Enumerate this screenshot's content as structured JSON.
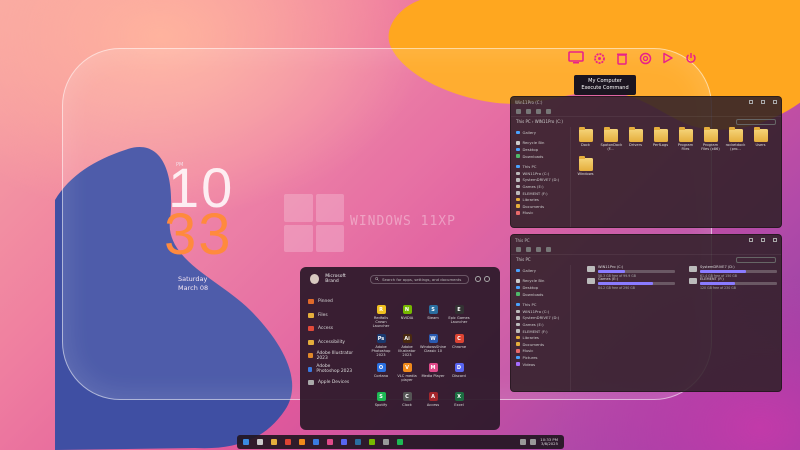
{
  "desktop": {
    "clock": {
      "small_label": "PM",
      "hour": "10",
      "minute": "33",
      "weekday": "Saturday",
      "date": "March 08"
    },
    "brand_title": "WINDOWS 11XP"
  },
  "top_icons": [
    {
      "name": "computer-icon",
      "color": "#e8218a"
    },
    {
      "name": "gear-icon",
      "color": "#e8218a"
    },
    {
      "name": "trash-icon",
      "color": "#e8218a"
    },
    {
      "name": "settings-icon",
      "color": "#e8218a"
    },
    {
      "name": "play-icon",
      "color": "#e8218a"
    },
    {
      "name": "power-icon",
      "color": "#e8218a"
    }
  ],
  "tooltip": {
    "title": "My Computer",
    "subtitle": "Execute Command"
  },
  "explorer1": {
    "title": "Win11Pro (C:)",
    "breadcrumb": "This PC  ›  WIN11Pro (C:)",
    "sidebar": [
      {
        "label": "Gallery",
        "color": "#4aa3ff"
      },
      {
        "label": "",
        "color": ""
      },
      {
        "label": "Recycle Bin",
        "color": "#cccccc"
      },
      {
        "label": "Desktop",
        "color": "#4aa3ff"
      },
      {
        "label": "Downloads",
        "color": "#4fb96a"
      },
      {
        "label": "",
        "color": ""
      },
      {
        "label": "This PC",
        "color": "#4aa3ff"
      },
      {
        "label": "WIN11Pro (C:)",
        "color": "#bbbbbb"
      },
      {
        "label": "SystemDRIVE7 (D:)",
        "color": "#bbbbbb"
      },
      {
        "label": "Games (E:)",
        "color": "#bbbbbb"
      },
      {
        "label": "ELEMENT (F:)",
        "color": "#bbbbbb"
      },
      {
        "label": "Libraries",
        "color": "#e5ae3c"
      },
      {
        "label": "Documents",
        "color": "#e5ae3c"
      },
      {
        "label": "Music",
        "color": "#e86a6a"
      }
    ],
    "folders": [
      "Dock",
      "SpotonDock (F...",
      "Drivers",
      "PerfLogs",
      "Program Files",
      "Program Files (x86)",
      "rocketdock (pro...",
      "Users",
      "Windows"
    ]
  },
  "explorer2": {
    "title": "This PC",
    "breadcrumb": "This PC",
    "sidebar": [
      {
        "label": "Gallery",
        "color": "#4aa3ff"
      },
      {
        "label": "",
        "color": ""
      },
      {
        "label": "Recycle Bin",
        "color": "#cccccc"
      },
      {
        "label": "Desktop",
        "color": "#4aa3ff"
      },
      {
        "label": "Downloads",
        "color": "#4fb96a"
      },
      {
        "label": "",
        "color": ""
      },
      {
        "label": "This PC",
        "color": "#4aa3ff"
      },
      {
        "label": "WIN11Pro (C:)",
        "color": "#bbbbbb"
      },
      {
        "label": "SystemDRIVE7 (D:)",
        "color": "#bbbbbb"
      },
      {
        "label": "Games (E:)",
        "color": "#bbbbbb"
      },
      {
        "label": "ELEMENT (F:)",
        "color": "#bbbbbb"
      },
      {
        "label": "Libraries",
        "color": "#e5ae3c"
      },
      {
        "label": "Documents",
        "color": "#e5ae3c"
      },
      {
        "label": "Music",
        "color": "#e86a6a"
      },
      {
        "label": "Pictures",
        "color": "#4aa3ff"
      },
      {
        "label": "Videos",
        "color": "#a66cff"
      }
    ],
    "drives": [
      {
        "name": "WIN11Pro (C:)",
        "used": 0.35,
        "free": "58.3 GB free of 99.9 GB"
      },
      {
        "name": "SystemDRIVE7 (D:)",
        "used": 0.6,
        "free": "61.4 GB free of 150 GB"
      },
      {
        "name": "Games (E:)",
        "used": 0.72,
        "free": "84.2 GB free of 290 GB"
      },
      {
        "name": "ELEMENT (F:)",
        "used": 0.45,
        "free": "120 GB free of 230 GB"
      }
    ]
  },
  "start_menu": {
    "user": "Microsoft Brand",
    "search_placeholder": "Search for apps, settings, and documents",
    "left": [
      {
        "label": "Pinned",
        "color": "#e06a2a"
      },
      {
        "label": "Files",
        "color": "#e5ae3c"
      },
      {
        "label": "Access",
        "color": "#e04a3a"
      },
      {
        "label": "Accessibility",
        "color": "#e5ae3c"
      },
      {
        "label": "Adobe Illustrator 2023",
        "color": "#e0882a"
      },
      {
        "label": "Adobe Photoshop 2023",
        "color": "#3a7ae0"
      },
      {
        "label": "Apple Devices",
        "color": "#aaaaaa"
      }
    ],
    "apps": [
      {
        "label": "Redfalls Crown Launcher",
        "icon": "R",
        "color": "#f0c020"
      },
      {
        "label": "NVIDIA",
        "icon": "N",
        "color": "#76b900"
      },
      {
        "label": "Steam",
        "icon": "S",
        "color": "#2a6ea0"
      },
      {
        "label": "Epic Games Launcher",
        "icon": "E",
        "color": "#333333"
      },
      {
        "label": "",
        "icon": "",
        "color": ""
      },
      {
        "label": "Adobe Photoshop 2023",
        "icon": "Ps",
        "color": "#1a3a70"
      },
      {
        "label": "Adobe Illustrator 2023",
        "icon": "Ai",
        "color": "#4a2a10"
      },
      {
        "label": "WindowsShine Classic 10",
        "icon": "W",
        "color": "#2a5ab0"
      },
      {
        "label": "Chrome",
        "icon": "C",
        "color": "#dd4433"
      },
      {
        "label": "",
        "icon": "",
        "color": ""
      },
      {
        "label": "Cortana",
        "icon": "O",
        "color": "#2a70e0"
      },
      {
        "label": "VLC media player",
        "icon": "V",
        "color": "#f08a1a"
      },
      {
        "label": "Media Player",
        "icon": "M",
        "color": "#e04a8a"
      },
      {
        "label": "Discord",
        "icon": "D",
        "color": "#5865f2"
      },
      {
        "label": "",
        "icon": "",
        "color": ""
      },
      {
        "label": "Spotify",
        "icon": "S",
        "color": "#1db954"
      },
      {
        "label": "Clock",
        "icon": "C",
        "color": "#555555"
      },
      {
        "label": "Access",
        "icon": "A",
        "color": "#a4262c"
      },
      {
        "label": "Excel",
        "icon": "X",
        "color": "#1d6f42"
      }
    ]
  },
  "taskbar": {
    "icons": [
      {
        "name": "start-icon",
        "color": "#3a8ae0"
      },
      {
        "name": "search-icon",
        "color": "#cccccc"
      },
      {
        "name": "explorer-icon",
        "color": "#e5ae3c"
      },
      {
        "name": "chrome-icon",
        "color": "#dd4433"
      },
      {
        "name": "vlc-icon",
        "color": "#f08a1a"
      },
      {
        "name": "photoshop-icon",
        "color": "#3a7ae0"
      },
      {
        "name": "media-icon",
        "color": "#e04a8a"
      },
      {
        "name": "discord-icon",
        "color": "#5865f2"
      },
      {
        "name": "steam-icon",
        "color": "#2a6ea0"
      },
      {
        "name": "nvidia-icon",
        "color": "#76b900"
      },
      {
        "name": "settings-icon",
        "color": "#999999"
      },
      {
        "name": "spotify-icon",
        "color": "#1db954"
      }
    ],
    "time": "10:33 PM",
    "date": "3/8/2025"
  }
}
